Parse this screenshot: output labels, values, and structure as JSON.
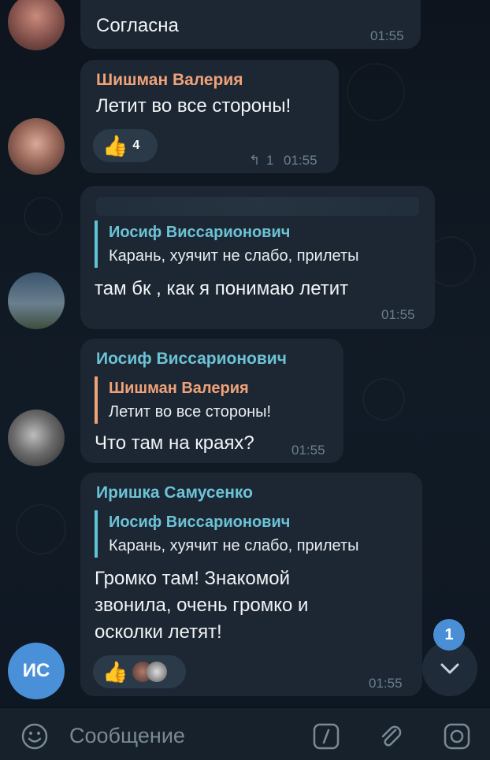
{
  "messages": [
    {
      "text": "Согласна",
      "time": "01:55"
    },
    {
      "sender": "Шишман Валерия",
      "sender_color": "#f0a279",
      "text": "Летит во все стороны!",
      "reaction_count": "4",
      "reply_count": "1",
      "time": "01:55"
    },
    {
      "reply_name": "Иосиф Виссарионович",
      "reply_text": "Карань, хуячит не слабо, прилеты",
      "text": "там бк , как я понимаю летит",
      "time": "01:55"
    },
    {
      "sender": "Иосиф Виссарионович",
      "sender_color": "#6cc3d5",
      "reply_name": "Шишман Валерия",
      "reply_text": "Летит во все стороны!",
      "text": "Что там на краях?",
      "time": "01:55"
    },
    {
      "sender": "Иришка Самусенко",
      "sender_color": "#6cc3d5",
      "reply_name": "Иосиф Виссарионович",
      "reply_text": "Карань, хуячит не слабо, прилеты",
      "text_lines": [
        "Громко там! Знакомой",
        "звонила, очень громко и",
        "осколки летят!"
      ],
      "time": "01:55"
    }
  ],
  "avatar_initials": "ИС",
  "scroll_badge": "1",
  "input": {
    "placeholder": "Сообщение"
  },
  "colors": {
    "accent": "#6cc3d5",
    "orange": "#f0a279",
    "bubble": "#1c2733",
    "avatar_blue": "#4a90d9"
  },
  "icons": [
    "emoji-icon",
    "command-icon",
    "attach-icon",
    "camera-icon",
    "chevron-down-icon",
    "thumbs-up-icon"
  ]
}
